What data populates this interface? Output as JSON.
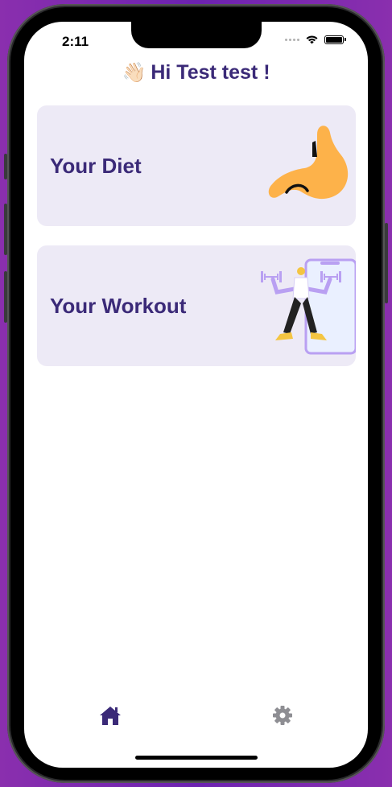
{
  "status_bar": {
    "time": "2:11"
  },
  "header": {
    "wave_emoji": "👋🏻",
    "greeting": "Hi Test test !"
  },
  "cards": [
    {
      "title": "Your Diet",
      "icon": "stomach-illustration"
    },
    {
      "title": "Your Workout",
      "icon": "workout-illustration"
    }
  ],
  "tab_bar": {
    "items": [
      {
        "icon": "home-icon",
        "active": true,
        "color": "#3b2a78"
      },
      {
        "icon": "gear-icon",
        "active": false,
        "color": "#8e8e93"
      }
    ]
  },
  "colors": {
    "accent": "#3b2a78",
    "card_background": "#edeaf6",
    "stomach": "#fdb24a",
    "workout_purple": "#b9a0f2"
  }
}
